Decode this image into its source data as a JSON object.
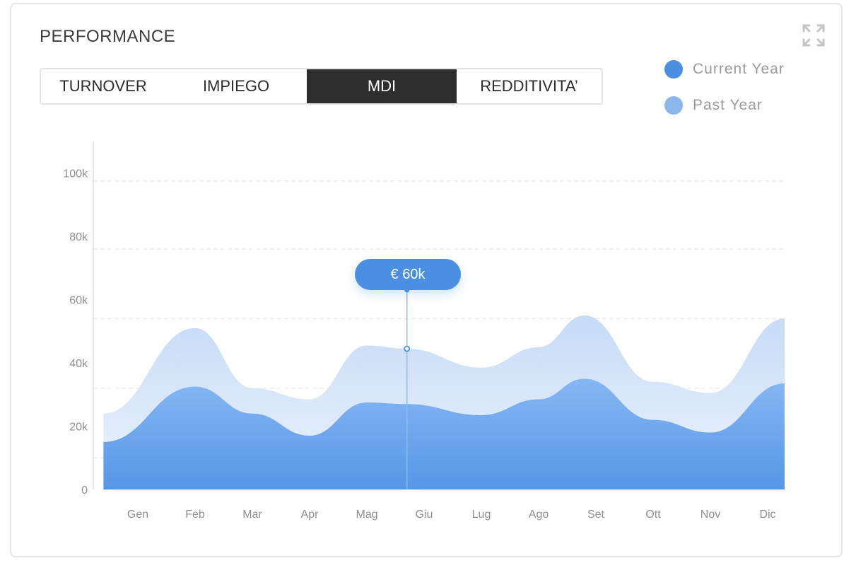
{
  "widget": {
    "title": "PERFORMANCE",
    "expand_icon": "expand-arrows-icon"
  },
  "tabs": [
    {
      "label": "TURNOVER",
      "active": false
    },
    {
      "label": "IMPIEGO",
      "active": false
    },
    {
      "label": "MDI",
      "active": true
    },
    {
      "label": "REDDITIVITA’",
      "active": false
    }
  ],
  "legend": [
    {
      "label": "Current Year",
      "color": "#4a8fe2"
    },
    {
      "label": "Past Year",
      "color": "#8ab6ec"
    }
  ],
  "tooltip": {
    "label": "€ 60k",
    "category": "Giu"
  },
  "chart_data": {
    "type": "area",
    "categories": [
      "Gen",
      "Feb",
      "Mar",
      "Apr",
      "Mag",
      "Giu",
      "Lug",
      "Ago",
      "Set",
      "Ott",
      "Nov",
      "Dic"
    ],
    "y_tick_labels": [
      "0",
      "20k",
      "40k",
      "60k",
      "80k",
      "100k"
    ],
    "y_ticks": [
      0,
      20000,
      40000,
      60000,
      80000,
      100000
    ],
    "ylim": [
      0,
      110000
    ],
    "x_points": [
      -0.6,
      1,
      2,
      3,
      4,
      4.7,
      6,
      7,
      7.8,
      9,
      10,
      11.3
    ],
    "series": [
      {
        "name": "Current Year",
        "values": [
          15000,
          32500,
          24000,
          17000,
          27500,
          27000,
          23500,
          28500,
          35000,
          22000,
          18000,
          33500
        ],
        "color": "#4a8fe2"
      },
      {
        "name": "Past Year",
        "values": [
          24000,
          51000,
          32000,
          28500,
          45500,
          44500,
          38500,
          45000,
          55000,
          34000,
          30500,
          54000
        ],
        "color": "#c8dcf5"
      }
    ],
    "grid": true,
    "legend_position": "top-right"
  }
}
